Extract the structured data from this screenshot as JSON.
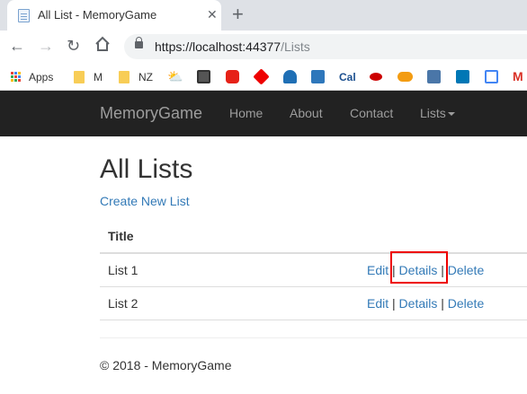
{
  "browser": {
    "tab_title": "All List - MemoryGame",
    "tab_close": "✕",
    "new_tab": "+",
    "url_host": "https://localhost:44377",
    "url_path": "/Lists"
  },
  "bookmarks": [
    {
      "label": "Apps",
      "icon": "apps-grid-icon"
    },
    {
      "label": "M",
      "icon": "folder-icon"
    },
    {
      "label": "NZ",
      "icon": "folder-icon"
    },
    {
      "label": "Cal",
      "icon": "cal-icon"
    }
  ],
  "navbar": {
    "brand": "MemoryGame",
    "links": [
      "Home",
      "About",
      "Contact",
      "Lists"
    ]
  },
  "page": {
    "title": "All Lists",
    "create_link": "Create New List",
    "table_header": "Title",
    "rows": [
      {
        "title": "List 1",
        "edit": "Edit",
        "details": "Details",
        "delete": "Delete"
      },
      {
        "title": "List 2",
        "edit": "Edit",
        "details": "Details",
        "delete": "Delete"
      }
    ],
    "separator": "|",
    "footer": "© 2018 - MemoryGame"
  },
  "colors": {
    "link": "#337ab7",
    "navbar_bg": "#222222",
    "highlight": "#ee0000"
  }
}
